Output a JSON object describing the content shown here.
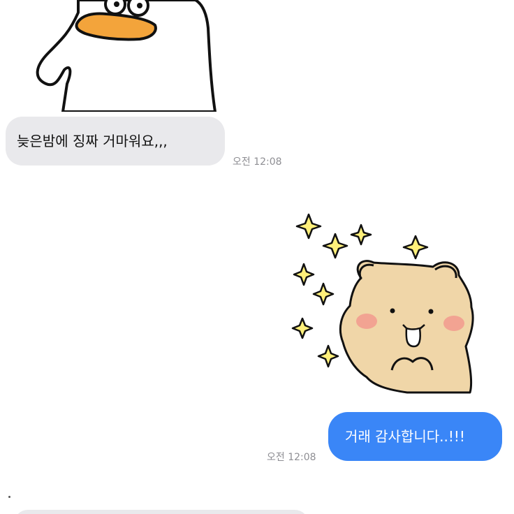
{
  "conversation": {
    "messages": [
      {
        "direction": "incoming",
        "sticker": "duck-sticker",
        "text": "늦은밤에 징짜 거마워요,,,",
        "time": "오전 12:08"
      },
      {
        "direction": "outgoing",
        "sticker": "bear-sparkle-sticker",
        "text": "거래 감사합니다..!!!",
        "time": "오전 12:08"
      }
    ]
  },
  "colors": {
    "incoming_bubble": "#e9e9ec",
    "outgoing_bubble": "#3a86f7",
    "timestamp": "#8e8e93",
    "duck_beak": "#f3a43b",
    "bear_fur": "#f0d6a8",
    "sparkle": "#fff07a"
  }
}
